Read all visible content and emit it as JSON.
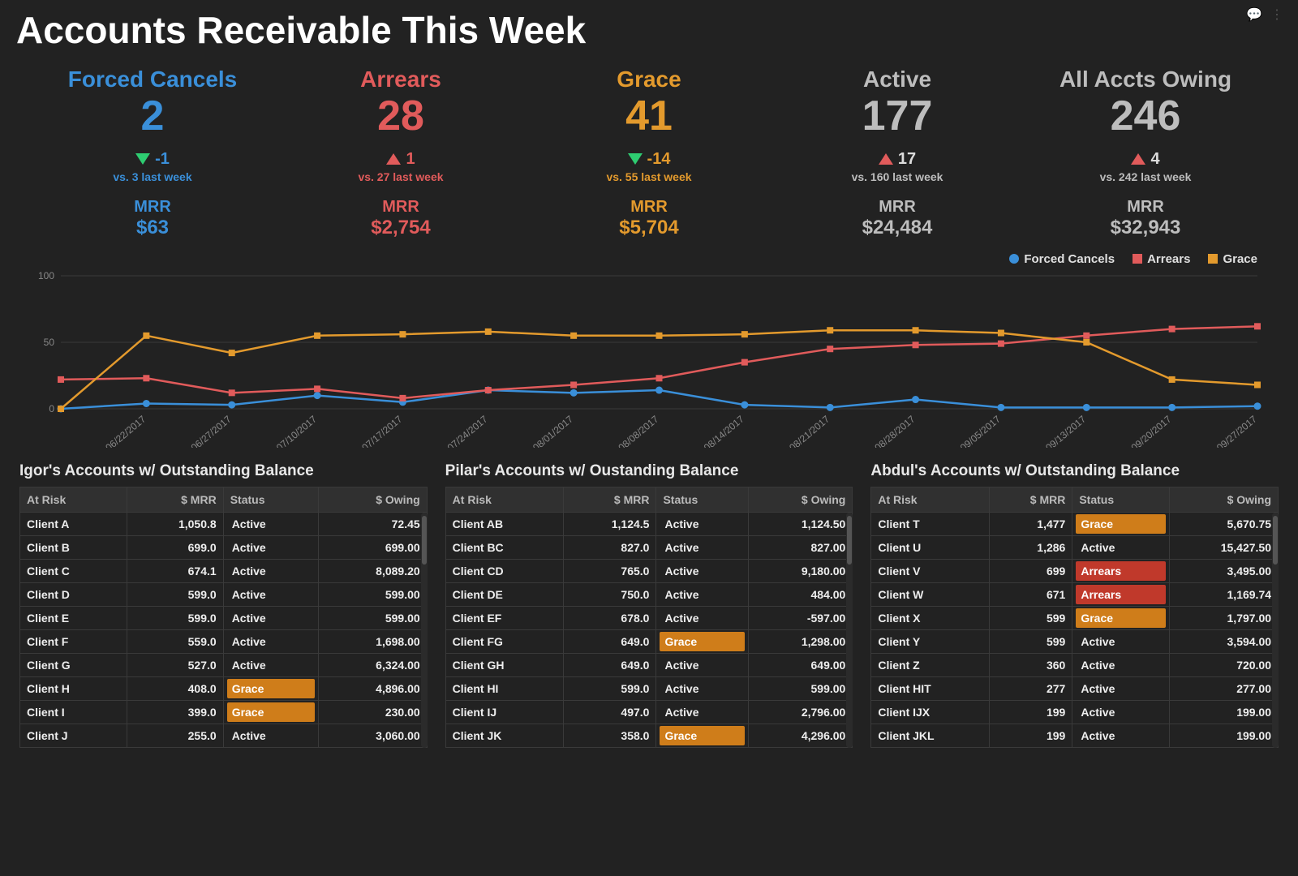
{
  "title": "Accounts Receivable This Week",
  "colors": {
    "blue": "#3a8fd9",
    "red": "#e15b5b",
    "orange": "#e39a2d",
    "gray": "#bdbdbd",
    "green": "#2ecc71",
    "status_grace_bg": "#cf7d1a",
    "status_arrears_bg": "#c0392b"
  },
  "kpis": [
    {
      "key": "forced_cancels",
      "title": "Forced Cancels",
      "value": "2",
      "delta": "-1",
      "delta_dir": "down",
      "vs": "vs. 3 last week",
      "mrr_label": "MRR",
      "mrr_value": "$63",
      "color": "blue"
    },
    {
      "key": "arrears",
      "title": "Arrears",
      "value": "28",
      "delta": "1",
      "delta_dir": "up",
      "vs": "vs. 27 last week",
      "mrr_label": "MRR",
      "mrr_value": "$2,754",
      "color": "red"
    },
    {
      "key": "grace",
      "title": "Grace",
      "value": "41",
      "delta": "-14",
      "delta_dir": "down",
      "vs": "vs. 55 last week",
      "mrr_label": "MRR",
      "mrr_value": "$5,704",
      "color": "orange"
    },
    {
      "key": "active",
      "title": "Active",
      "value": "177",
      "delta": "17",
      "delta_dir": "up",
      "vs": "vs. 160 last week",
      "mrr_label": "MRR",
      "mrr_value": "$24,484",
      "color": "gray"
    },
    {
      "key": "all_owing",
      "title": "All Accts Owing",
      "value": "246",
      "delta": "4",
      "delta_dir": "up",
      "vs": "vs. 242 last week",
      "mrr_label": "MRR",
      "mrr_value": "$32,943",
      "color": "gray"
    }
  ],
  "legend": [
    {
      "label": "Forced Cancels",
      "color": "blue",
      "shape": "dot"
    },
    {
      "label": "Arrears",
      "color": "red",
      "shape": "sq"
    },
    {
      "label": "Grace",
      "color": "orange",
      "shape": "sq"
    }
  ],
  "chart_data": {
    "type": "line",
    "title": "",
    "xlabel": "",
    "ylabel": "",
    "ylim": [
      0,
      100
    ],
    "yticks": [
      0,
      50,
      100
    ],
    "categories": [
      "06/22/2017",
      "06/27/2017",
      "07/10/2017",
      "07/17/2017",
      "07/24/2017",
      "08/01/2017",
      "08/08/2017",
      "08/14/2017",
      "08/21/2017",
      "08/28/2017",
      "09/05/2017",
      "09/13/2017",
      "09/20/2017",
      "09/27/2017"
    ],
    "series": [
      {
        "name": "Forced Cancels",
        "color": "blue",
        "marker": "circle",
        "values": [
          0,
          4,
          3,
          10,
          5,
          14,
          12,
          14,
          3,
          1,
          7,
          1,
          1,
          1,
          2
        ]
      },
      {
        "name": "Arrears",
        "color": "red",
        "marker": "square",
        "values": [
          22,
          23,
          12,
          15,
          8,
          14,
          18,
          23,
          35,
          45,
          48,
          49,
          55,
          60,
          62
        ]
      },
      {
        "name": "Grace",
        "color": "orange",
        "marker": "square",
        "values": [
          0,
          55,
          42,
          55,
          56,
          58,
          55,
          55,
          56,
          59,
          59,
          57,
          50,
          22,
          18
        ]
      }
    ]
  },
  "tables": [
    {
      "title": "Igor's Accounts w/ Outstanding Balance",
      "columns": [
        "At Risk",
        "$ MRR",
        "Status",
        "$ Owing"
      ],
      "rows": [
        {
          "client": "Client A",
          "mrr": "1,050.8",
          "status": "Active",
          "owing": "72.45"
        },
        {
          "client": "Client B",
          "mrr": "699.0",
          "status": "Active",
          "owing": "699.00"
        },
        {
          "client": "Client C",
          "mrr": "674.1",
          "status": "Active",
          "owing": "8,089.20"
        },
        {
          "client": "Client D",
          "mrr": "599.0",
          "status": "Active",
          "owing": "599.00"
        },
        {
          "client": "Client E",
          "mrr": "599.0",
          "status": "Active",
          "owing": "599.00"
        },
        {
          "client": "Client F",
          "mrr": "559.0",
          "status": "Active",
          "owing": "1,698.00"
        },
        {
          "client": "Client G",
          "mrr": "527.0",
          "status": "Active",
          "owing": "6,324.00"
        },
        {
          "client": "Client H",
          "mrr": "408.0",
          "status": "Grace",
          "owing": "4,896.00"
        },
        {
          "client": "Client I",
          "mrr": "399.0",
          "status": "Grace",
          "owing": "230.00"
        },
        {
          "client": "Client J",
          "mrr": "255.0",
          "status": "Active",
          "owing": "3,060.00"
        }
      ]
    },
    {
      "title": "Pilar's Accounts w/ Oustanding Balance",
      "columns": [
        "At Risk",
        "$ MRR",
        "Status",
        "$ Owing"
      ],
      "rows": [
        {
          "client": "Client AB",
          "mrr": "1,124.5",
          "status": "Active",
          "owing": "1,124.50"
        },
        {
          "client": "Client BC",
          "mrr": "827.0",
          "status": "Active",
          "owing": "827.00"
        },
        {
          "client": "Client CD",
          "mrr": "765.0",
          "status": "Active",
          "owing": "9,180.00"
        },
        {
          "client": "Client DE",
          "mrr": "750.0",
          "status": "Active",
          "owing": "484.00"
        },
        {
          "client": "Client EF",
          "mrr": "678.0",
          "status": "Active",
          "owing": "-597.00"
        },
        {
          "client": "Client FG",
          "mrr": "649.0",
          "status": "Grace",
          "owing": "1,298.00"
        },
        {
          "client": "Client GH",
          "mrr": "649.0",
          "status": "Active",
          "owing": "649.00"
        },
        {
          "client": "Client HI",
          "mrr": "599.0",
          "status": "Active",
          "owing": "599.00"
        },
        {
          "client": "Client IJ",
          "mrr": "497.0",
          "status": "Active",
          "owing": "2,796.00"
        },
        {
          "client": "Client JK",
          "mrr": "358.0",
          "status": "Grace",
          "owing": "4,296.00"
        }
      ]
    },
    {
      "title": "Abdul's Accounts w/ Outstanding Balance",
      "columns": [
        "At Risk",
        "$ MRR",
        "Status",
        "$ Owing"
      ],
      "rows": [
        {
          "client": "Client T",
          "mrr": "1,477",
          "status": "Grace",
          "owing": "5,670.75"
        },
        {
          "client": "Client U",
          "mrr": "1,286",
          "status": "Active",
          "owing": "15,427.50"
        },
        {
          "client": "Client V",
          "mrr": "699",
          "status": "Arrears",
          "owing": "3,495.00"
        },
        {
          "client": "Client W",
          "mrr": "671",
          "status": "Arrears",
          "owing": "1,169.74"
        },
        {
          "client": "Client X",
          "mrr": "599",
          "status": "Grace",
          "owing": "1,797.00"
        },
        {
          "client": "Client Y",
          "mrr": "599",
          "status": "Active",
          "owing": "3,594.00"
        },
        {
          "client": "Client Z",
          "mrr": "360",
          "status": "Active",
          "owing": "720.00"
        },
        {
          "client": "Client HIT",
          "mrr": "277",
          "status": "Active",
          "owing": "277.00"
        },
        {
          "client": "Client IJX",
          "mrr": "199",
          "status": "Active",
          "owing": "199.00"
        },
        {
          "client": "Client JKL",
          "mrr": "199",
          "status": "Active",
          "owing": "199.00"
        }
      ]
    }
  ]
}
